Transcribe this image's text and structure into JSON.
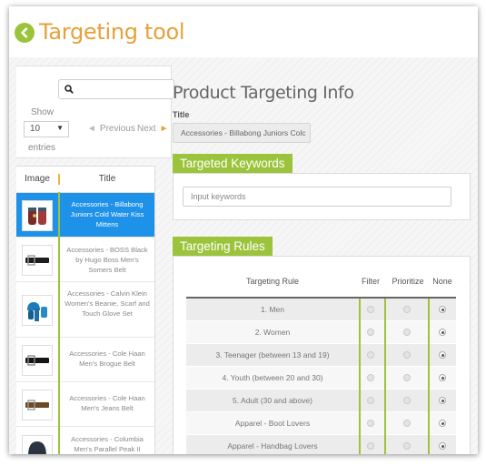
{
  "header": {
    "title": "Targeting tool",
    "back_icon": "chevron-left-icon",
    "accent_color": "#e6a13b",
    "green_color": "#9bc43c"
  },
  "controls": {
    "search_placeholder": "",
    "show_label": "Show",
    "entries_value": "10",
    "entries_label": "entries",
    "previous_label": "Previous",
    "next_label": "Next"
  },
  "table": {
    "columns": [
      "Image",
      "Title"
    ],
    "selected_color": "#1e91e8",
    "rows": [
      {
        "title": "Accessories - Billabong Juniors Cold Water Kiss Mittens",
        "icon": "mittens-icon",
        "selected": true
      },
      {
        "title": "Accessories - BOSS Black by Hugo Boss Men's Somers Belt",
        "icon": "belt-icon",
        "selected": false
      },
      {
        "title": "Accessories - Calvin Klein Women's Beanie, Scarf and Touch Glove Set",
        "icon": "beanie-set-icon",
        "selected": false
      },
      {
        "title": "Accessories - Cole Haan Men's Brogue Belt",
        "icon": "belt-icon",
        "selected": false
      },
      {
        "title": "Accessories - Cole Haan Men's Jeans Belt",
        "icon": "belt-icon",
        "selected": false
      },
      {
        "title": "Accessories - Columbia Men's Parallel Peak II Beanie",
        "icon": "beanie-icon",
        "selected": false
      }
    ]
  },
  "info": {
    "heading": "Product Targeting Info",
    "title_label": "Title",
    "title_value": "Accessories - Billabong Juniors Colc"
  },
  "keywords": {
    "tab_label": "Targeted Keywords",
    "input_placeholder": "Input keywords"
  },
  "rules": {
    "tab_label": "Targeting Rules",
    "columns": [
      "Targeting Rule",
      "Filter",
      "Prioritize",
      "None"
    ],
    "rows": [
      {
        "label": "1. Men",
        "selected": "None"
      },
      {
        "label": "2. Women",
        "selected": "None"
      },
      {
        "label": "3. Teenager (between 13 and 19)",
        "selected": "None"
      },
      {
        "label": "4. Youth (between 20 and 30)",
        "selected": "None"
      },
      {
        "label": "5. Adult (30 and above)",
        "selected": "None"
      },
      {
        "label": "Apparel - Boot Lovers",
        "selected": "None"
      },
      {
        "label": "Apparel - Handbag Lovers",
        "selected": "None"
      }
    ]
  }
}
